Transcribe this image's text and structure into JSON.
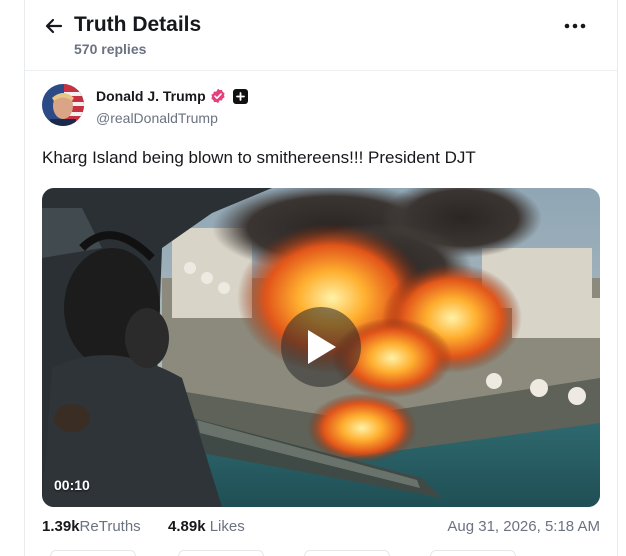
{
  "header": {
    "title": "Truth Details",
    "replies": "570 replies",
    "back_icon": "arrow-left-icon",
    "more_icon": "more-horizontal-icon"
  },
  "author": {
    "name": "Donald J. Trump",
    "handle": "@realDonaldTrump",
    "verified_color": "#e4407b"
  },
  "post": {
    "text": "Kharg Island being blown to smithereens!!! President DJT"
  },
  "media": {
    "duration": "00:10",
    "play_icon": "play-icon"
  },
  "stats": {
    "retruths_count": "1.39k",
    "retruths_label": "ReTruths",
    "likes_count": "4.89k",
    "likes_label": "Likes",
    "timestamp": "Aug 31, 2026, 5:18 AM"
  }
}
